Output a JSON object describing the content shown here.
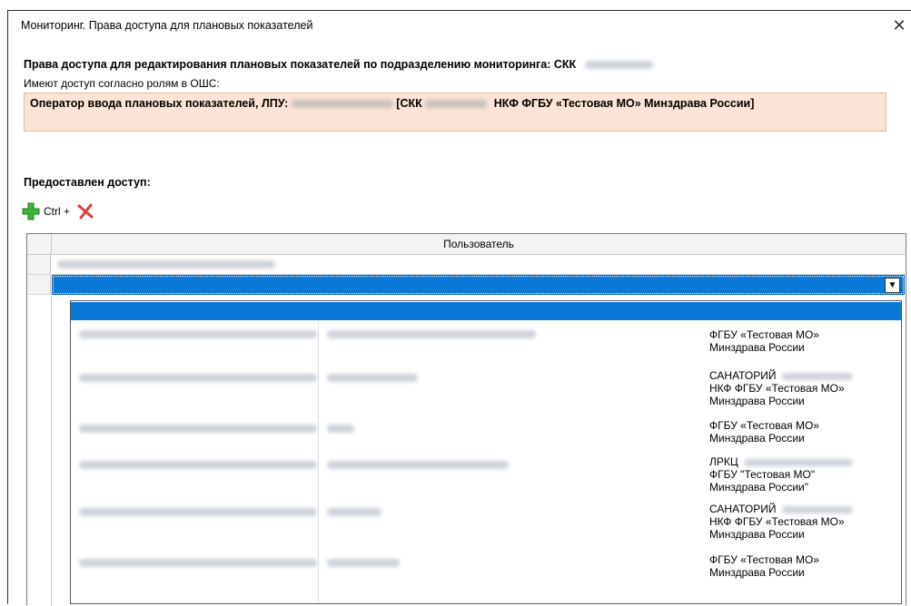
{
  "window": {
    "title": "Мониторинг. Права доступа для плановых показателей",
    "close_symbol": "✕"
  },
  "content": {
    "heading": "Права доступа для редактирования плановых показателей по подразделению мониторинга: СКК",
    "sub_heading": "Имеют доступ согласно ролям в ОШС:",
    "role_line": {
      "prefix": "Оператор ввода плановых показателей, ЛПУ:",
      "mid": "[СКК",
      "suffix": "НКФ ФГБУ «Тестовая МО» Минздрава России]"
    },
    "granted_label": "Предоставлен доступ:",
    "toolbar": {
      "add_icon": "add-plus-icon",
      "ctrl_label": "Ctrl +",
      "delete_icon": "delete-x-icon"
    }
  },
  "grid": {
    "column_header": "Пользователь",
    "combo_button_symbol": "▼"
  },
  "dropdown": {
    "items": [
      {
        "org_line1": "ФГБУ «Тестовая МО»",
        "org_line2": "Минздрава России",
        "org_line3": ""
      },
      {
        "org_line1": "САНАТОРИЙ",
        "org_line2": "НКФ ФГБУ «Тестовая МО»",
        "org_line3": "Минздрава России"
      },
      {
        "org_line1": "ФГБУ «Тестовая МО»",
        "org_line2": "Минздрава России",
        "org_line3": ""
      },
      {
        "org_line1": "ЛРКЦ",
        "org_line2": "ФГБУ \"Тестовая МО\"",
        "org_line3": "Минздрава России\""
      },
      {
        "org_line1": "САНАТОРИЙ",
        "org_line2": "НКФ ФГБУ «Тестовая МО»",
        "org_line3": "Минздрава России"
      },
      {
        "org_line1": "ФГБУ «Тестовая МО»",
        "org_line2": "Минздрава России",
        "org_line3": ""
      }
    ]
  },
  "colors": {
    "selection": "#0a78d7",
    "role_box_bg": "#fbe4d5",
    "add_icon": "#3cb43c",
    "delete_icon": "#e03c3c"
  }
}
